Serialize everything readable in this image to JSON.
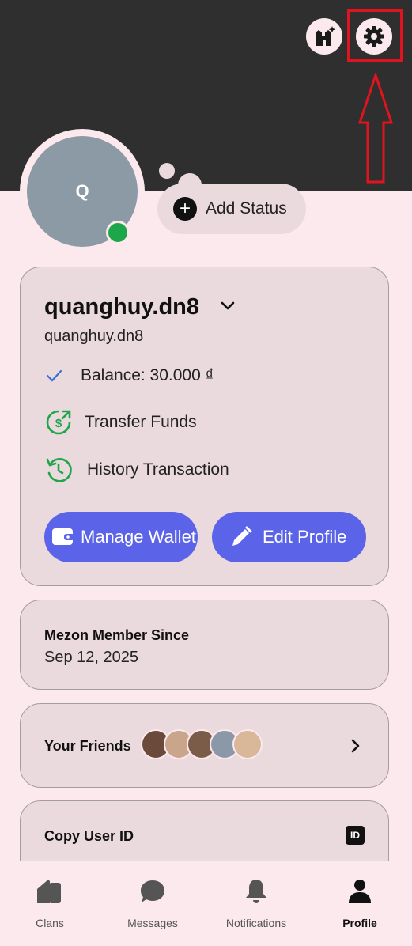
{
  "profile": {
    "avatar_initial": "Q",
    "add_status_label": "Add Status",
    "display_name": "quanghuy.dn8",
    "username": "quanghuy.dn8",
    "balance_label": "Balance: 30.000 ₫",
    "transfer_label": "Transfer Funds",
    "history_label": "History Transaction",
    "manage_wallet_label": "Manage Wallet",
    "edit_profile_label": "Edit Profile"
  },
  "member": {
    "title": "Mezon Member Since",
    "date": "Sep 12, 2025"
  },
  "friends": {
    "title": "Your Friends",
    "avatar_colors": [
      "#6b4a3c",
      "#c9a58c",
      "#7a5c48",
      "#8a98a8",
      "#d8b898"
    ]
  },
  "copy_id": {
    "label": "Copy User ID",
    "badge": "ID"
  },
  "nav": {
    "items": [
      {
        "label": "Clans"
      },
      {
        "label": "Messages"
      },
      {
        "label": "Notifications"
      },
      {
        "label": "Profile"
      }
    ]
  },
  "colors": {
    "header_bg": "#2f2f2f",
    "page_bg": "#fbe9ee",
    "card_bg": "#ead9dd",
    "accent": "#5b63e8",
    "online": "#1ea64a",
    "highlight": "#e0141e",
    "success_icon": "#1ea64a",
    "check": "#3a6fd8"
  }
}
